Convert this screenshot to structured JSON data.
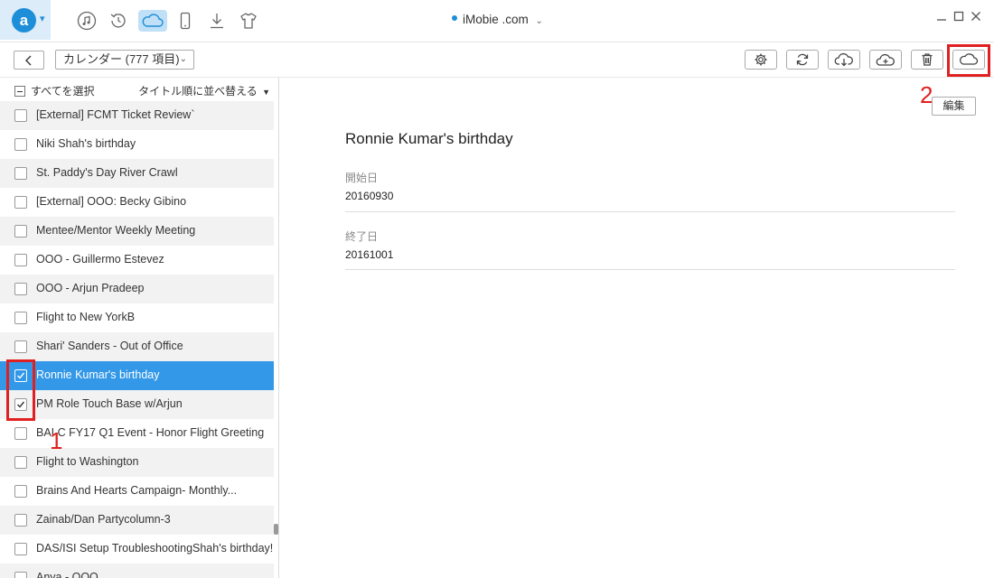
{
  "titlebar": {
    "app_logo_letter": "a",
    "account_name": "iMobie .com",
    "nav_icons": [
      "music-icon",
      "history-icon",
      "icloud-icon",
      "phone-icon",
      "download-icon",
      "shirt-icon"
    ]
  },
  "toolbar": {
    "category_label": "カレンダー (777 項目)"
  },
  "list": {
    "select_all_label": "すべてを選択",
    "sort_label": "タイトル順に並べ替える",
    "items": [
      {
        "label": "[External] FCMT Ticket Review`",
        "checked": false
      },
      {
        "label": "Niki Shah's birthday",
        "checked": false
      },
      {
        "label": "St. Paddy's Day River Crawl",
        "checked": false
      },
      {
        "label": "[External] OOO: Becky Gibino",
        "checked": false
      },
      {
        "label": "Mentee/Mentor Weekly Meeting",
        "checked": false
      },
      {
        "label": "OOO - Guillermo Estevez",
        "checked": false
      },
      {
        "label": "OOO - Arjun Pradeep",
        "checked": false
      },
      {
        "label": "Flight to New YorkB",
        "checked": false
      },
      {
        "label": "Shari' Sanders - Out of Office",
        "checked": false
      },
      {
        "label": "Ronnie Kumar's birthday",
        "checked": true,
        "selected": true
      },
      {
        "label": "PM Role Touch Base w/Arjun",
        "checked": true
      },
      {
        "label": "BAI C FY17 Q1 Event - Honor Flight Greeting",
        "checked": false
      },
      {
        "label": "Flight to Washington",
        "checked": false
      },
      {
        "label": "Brains And Hearts Campaign- Monthly...",
        "checked": false
      },
      {
        "label": "Zainab/Dan Partycolumn-3",
        "checked": false
      },
      {
        "label": "DAS/ISI Setup TroubleshootingShah's birthday!",
        "checked": false
      },
      {
        "label": "Anya - OOO",
        "checked": false
      }
    ]
  },
  "detail": {
    "title": "Ronnie Kumar's birthday",
    "edit_label": "編集",
    "start_label": "開始日",
    "start_value": "20160930",
    "end_label": "終了日",
    "end_value": "20161001"
  },
  "annotations": {
    "step1": "1",
    "step2": "2"
  },
  "colors": {
    "accent": "#1e8ed8",
    "selected_row": "#3398e8",
    "highlight": "#e02020"
  }
}
